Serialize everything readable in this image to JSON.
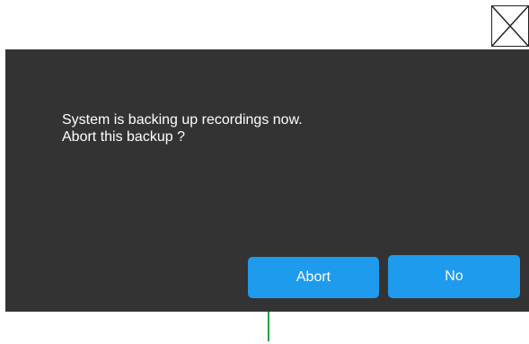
{
  "dialog": {
    "message_line1": "System is backing up recordings now.",
    "message_line2": "Abort this backup ?",
    "abort_label": "Abort",
    "no_label": "No",
    "close_icon": "close-icon"
  },
  "colors": {
    "dialog_background": "#333333",
    "button_blue": "#1e9bec",
    "text": "#ffffff",
    "indicator_green": "#25a344"
  }
}
